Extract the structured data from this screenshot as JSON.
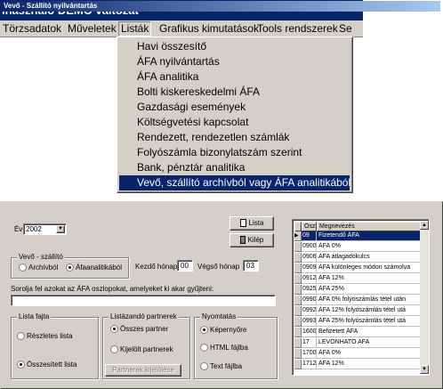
{
  "app": {
    "title": "lhasználó  DEMÓ változat",
    "menu": [
      "Törzsadatok",
      "Műveletek",
      "Listák",
      "Grafikus kimutatások",
      "Tools rendszerek",
      "Se"
    ]
  },
  "dropdown": {
    "items": [
      "Havi összesítő",
      "ÁFA nyilvántartás",
      "ÁFA analitika",
      "Bolti kiskereskedelmi ÁFA",
      "Gazdasági események",
      "Költségvetési kapcsolat",
      "Rendezett, rendezetlen számlák",
      "Folyószámla bizonylatszám szerint",
      "Bank, pénztár analitika",
      "Vevő, szállító archívból vagy ÁFA analitikából"
    ]
  },
  "dialog": {
    "title": "Vevő - Szállító nyilvántartás",
    "year_label": "Év",
    "year_value": "2002",
    "buttons": {
      "lista": "Lista",
      "kilep": "Kilép",
      "partnerek_kijelolese": "Partnerek kijelölése"
    },
    "source_group": {
      "title": "Vevő - szállító",
      "options": [
        "Archívból",
        "Áfaanalitikából"
      ]
    },
    "kezdo_label": "Kezdő hónap",
    "kezdo_value": "00",
    "vegso_label": "Végső hónap",
    "vegso_value": "03",
    "columns_prompt": "Sorolja fel azokat az ÁFA oszlopokat, amelyeket ki akar gyűjteni:",
    "columns_value": "",
    "list_type": {
      "title": "Lista fajta",
      "options": [
        "Részletes lista",
        "Összesített lista"
      ]
    },
    "partners": {
      "title": "Listázandó partnerek",
      "options": [
        "Összes partner",
        "Kijelölt partnerek"
      ]
    },
    "print": {
      "title": "Nyomtatás",
      "options": [
        "Képernyőre",
        "HTML fájlba",
        "Text fájlba"
      ]
    },
    "grid": {
      "headers": [
        "Oszl",
        "Megnevezés"
      ],
      "rows": [
        [
          "09",
          "Fizetendő ÁFA"
        ],
        [
          "0900",
          "ÁFA  0%"
        ],
        [
          "0906",
          "ÁFA átlagadókulcs"
        ],
        [
          "0909",
          "ÁFA különleges módon számolva"
        ],
        [
          "0912",
          "ÁFA 12%"
        ],
        [
          "0925",
          "ÁFA 25%"
        ],
        [
          "0990",
          "ÁFA 0% folyószámlás tétel után"
        ],
        [
          "0992",
          "ÁFA 12% folyószámlás tétel utá"
        ],
        [
          "0993",
          "ÁFA 25% folyószámlás tétel utá"
        ],
        [
          "1600",
          "Befizetett ÁFA"
        ],
        [
          "17",
          "LEVONHATO AFA"
        ],
        [
          "1700",
          "ÁFA  0%"
        ],
        [
          "1712",
          "ÁFA 12%"
        ]
      ]
    }
  }
}
